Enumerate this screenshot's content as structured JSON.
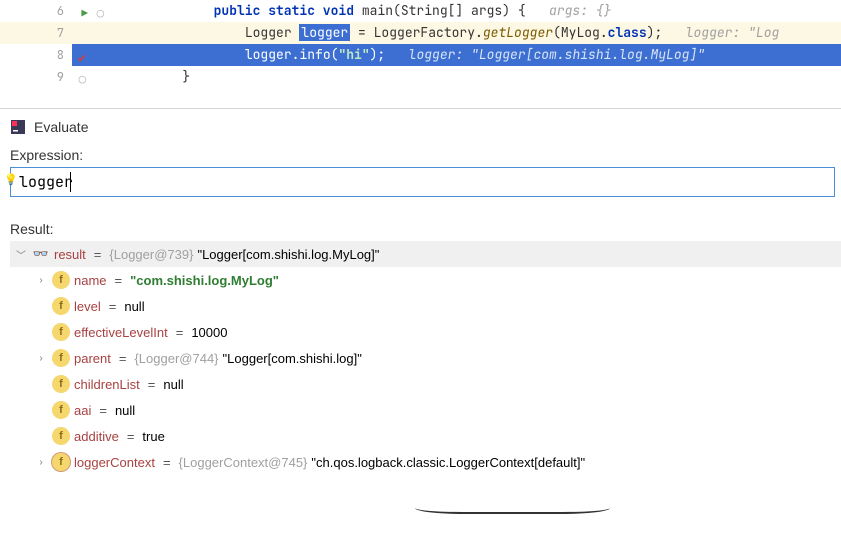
{
  "editor": {
    "lines": [
      {
        "num": "6",
        "run": true,
        "shield": true,
        "indent": "            ",
        "tokens": "public static void main(String[] args) {",
        "hint": "args: {}"
      },
      {
        "num": "7",
        "hl": true,
        "indent": "                ",
        "part1": "Logger ",
        "varsel": "logger",
        "part2": " = LoggerFactory.",
        "method": "getLogger",
        "part3": "(MyLog.",
        "kw2": "class",
        "part4": ");",
        "hint": "logger: \"Log"
      },
      {
        "num": "8",
        "bp": true,
        "exec": true,
        "indent": "                ",
        "code": "logger.info(",
        "str": "\"hi\"",
        "code2": ");",
        "hint": "logger: \"Logger[com.shishi.log.MyLog]\""
      },
      {
        "num": "9",
        "shield": true,
        "indent": "        ",
        "code": "}"
      }
    ]
  },
  "panel": {
    "title": "Evaluate",
    "expression_label": "Expression:",
    "expression_value": "logger",
    "result_label": "Result:"
  },
  "tree": {
    "root": {
      "name": "result",
      "ref": "{Logger@739}",
      "val": "\"Logger[com.shishi.log.MyLog]\""
    },
    "children": [
      {
        "chev": true,
        "name": "name",
        "valGreen": "\"com.shishi.log.MyLog\""
      },
      {
        "name": "level",
        "valPlain": "null"
      },
      {
        "name": "effectiveLevelInt",
        "valPlain": "10000"
      },
      {
        "chev": true,
        "name": "parent",
        "ref": "{Logger@744}",
        "val": "\"Logger[com.shishi.log]\""
      },
      {
        "name": "childrenList",
        "valPlain": "null"
      },
      {
        "name": "aai",
        "valPlain": "null"
      },
      {
        "name": "additive",
        "valPlain": "true"
      },
      {
        "chev": true,
        "pin": true,
        "name": "loggerContext",
        "ref": "{LoggerContext@745}",
        "val": "\"ch.qos.logback.classic.LoggerContext[default]\""
      }
    ]
  }
}
